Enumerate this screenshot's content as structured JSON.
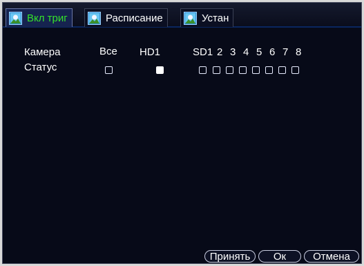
{
  "tabs": [
    {
      "label": "Вкл триг",
      "active": true,
      "icon": "camera-image-icon"
    },
    {
      "label": "Расписание",
      "active": false,
      "icon": "camera-image-icon"
    },
    {
      "label": "Устан",
      "active": false,
      "icon": "camera-image-icon"
    }
  ],
  "row_labels": {
    "camera": "Камера",
    "status": "Статус"
  },
  "columns": {
    "all": "Все",
    "hd1": "HD1",
    "sd1": "SD1",
    "channels": [
      "2",
      "3",
      "4",
      "5",
      "6",
      "7",
      "8"
    ]
  },
  "status": {
    "all": false,
    "hd1": true,
    "channels": [
      false,
      false,
      false,
      false,
      false,
      false,
      false,
      false
    ]
  },
  "buttons": {
    "apply": "Принять",
    "ok": "Ок",
    "cancel": "Отмена"
  },
  "colors": {
    "background": "#070a18",
    "active_tab_text": "#35e22a",
    "text": "#ffffff"
  }
}
